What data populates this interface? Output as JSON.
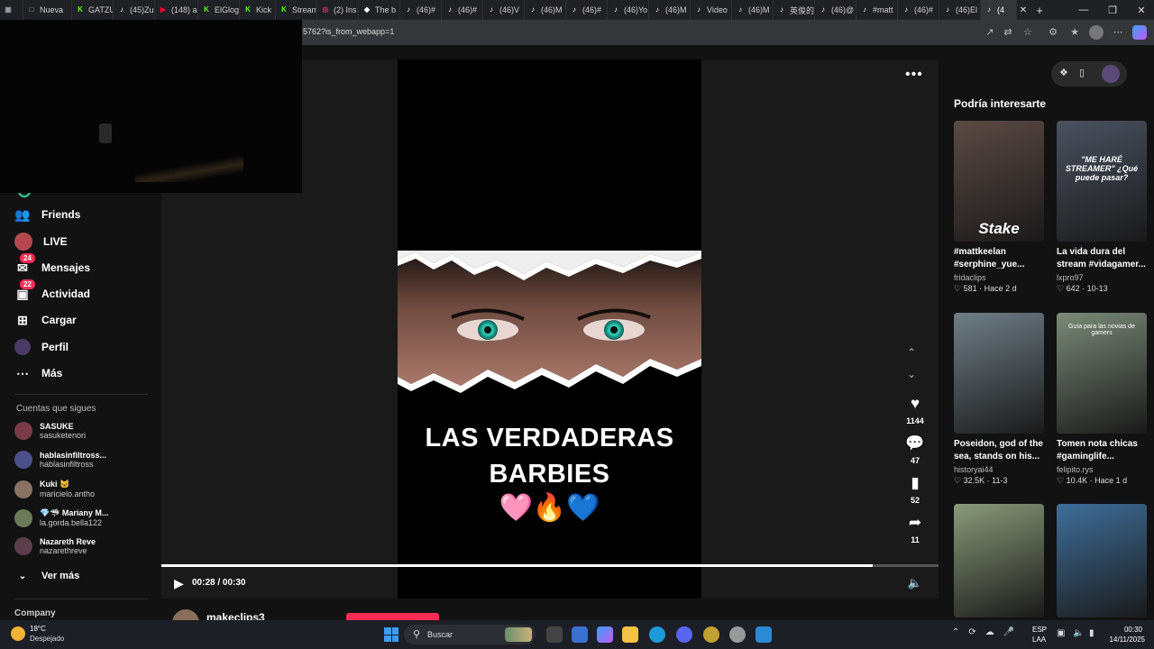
{
  "browser": {
    "tabs": [
      {
        "label": "",
        "icon": "window-icon",
        "color": "#9aa0a6"
      },
      {
        "label": "Nueva",
        "icon": "newtab-icon",
        "color": "#9aa0a6"
      },
      {
        "label": "GATZU",
        "icon": "kick-icon",
        "color": "#53fc18"
      },
      {
        "label": "(45)Zu",
        "icon": "tiktok-icon",
        "color": "#ffffff"
      },
      {
        "label": "(148) a",
        "icon": "youtube-icon",
        "color": "#ff0033"
      },
      {
        "label": "ElGlog",
        "icon": "kick-icon",
        "color": "#53fc18"
      },
      {
        "label": "Kick",
        "icon": "kick-icon",
        "color": "#53fc18"
      },
      {
        "label": "Stream",
        "icon": "kick-icon",
        "color": "#53fc18"
      },
      {
        "label": "(2) Ins",
        "icon": "instagram-icon",
        "color": "#e1306c"
      },
      {
        "label": "The b",
        "icon": "site-icon",
        "color": "#ffffff"
      },
      {
        "label": "(46)#",
        "icon": "tiktok-icon",
        "color": "#ffffff"
      },
      {
        "label": "(46)#",
        "icon": "tiktok-icon",
        "color": "#ffffff"
      },
      {
        "label": "(46)V",
        "icon": "tiktok-icon",
        "color": "#ffffff"
      },
      {
        "label": "(46)M",
        "icon": "tiktok-icon",
        "color": "#ffffff"
      },
      {
        "label": "(46)#",
        "icon": "tiktok-icon",
        "color": "#ffffff"
      },
      {
        "label": "(46)Yo",
        "icon": "tiktok-icon",
        "color": "#ffffff"
      },
      {
        "label": "(46)M",
        "icon": "tiktok-icon",
        "color": "#ffffff"
      },
      {
        "label": "Video",
        "icon": "tiktok-icon",
        "color": "#ffffff"
      },
      {
        "label": "(46)M",
        "icon": "tiktok-icon",
        "color": "#ffffff"
      },
      {
        "label": "英俊的",
        "icon": "tiktok-icon",
        "color": "#ffffff"
      },
      {
        "label": "(46)@",
        "icon": "tiktok-icon",
        "color": "#ffffff"
      },
      {
        "label": "#matt",
        "icon": "tiktok-icon",
        "color": "#ffffff"
      },
      {
        "label": "(46)#",
        "icon": "tiktok-icon",
        "color": "#ffffff"
      },
      {
        "label": "(46)El",
        "icon": "tiktok-icon",
        "color": "#ffffff"
      },
      {
        "label": "(4",
        "icon": "tiktok-icon",
        "color": "#ffffff",
        "active": true
      }
    ],
    "url": "5762?is_from_webapp=1"
  },
  "sidebar": {
    "nav": [
      {
        "label": "Friends",
        "icon": "friends-icon"
      },
      {
        "label": "LIVE",
        "icon": "live-icon"
      },
      {
        "label": "Mensajes",
        "icon": "messages-icon",
        "badge": "24"
      },
      {
        "label": "Actividad",
        "icon": "activity-icon",
        "badge": "22"
      },
      {
        "label": "Cargar",
        "icon": "upload-icon"
      },
      {
        "label": "Perfil",
        "icon": "profile-icon"
      },
      {
        "label": "Más",
        "icon": "more-icon"
      }
    ],
    "following_title": "Cuentas que sigues",
    "following": [
      {
        "name": "SASUKE",
        "handle": "sasuketenori",
        "color": "#7a3b48"
      },
      {
        "name": "hablasinfiltross...",
        "handle": "hablasinfiltross",
        "color": "#4b4f8a"
      },
      {
        "name": "Kuki 🐱",
        "handle": "maricielo.antho",
        "color": "#8a7263"
      },
      {
        "name": "💎🦈 Mariany M...",
        "handle": "la.gorda.bella122",
        "color": "#6b7a58"
      },
      {
        "name": "Nazareth Reve",
        "handle": "nazarethreve",
        "color": "#5a3f4a"
      }
    ],
    "see_more": "Ver más",
    "company": "Company"
  },
  "video": {
    "caption_line1": "LAS VERDADERAS",
    "caption_line2": "BARBIES",
    "emojis": "🩷🔥💙",
    "time": "00:28 / 00:30",
    "progress": 0.915,
    "author": "makeclips3",
    "likes": "1144",
    "comments": "47",
    "saves": "52",
    "shares": "11"
  },
  "recommendations": {
    "title": "Podría interesarte",
    "cards": [
      {
        "title": "#mattkeelan #serphine_yue...",
        "author": "fridaclips",
        "likes": "581",
        "when": "Hace 2 d",
        "bg": "#5b4a44",
        "overlay": "Stake"
      },
      {
        "title": "La vida dura del stream #vidagamer...",
        "author": "lxpro97",
        "likes": "642",
        "when": "10-13",
        "bg": "#4a5260",
        "overlay": "\"ME HARÉ STREAMER\" ¿Qué puede pasar?"
      },
      {
        "title": "Poseidon, god of the sea, stands on his...",
        "author": "historyai44",
        "likes": "32.5K",
        "when": "11-3",
        "bg": "#6f7e86",
        "overlay": ""
      },
      {
        "title": "Tomen nota chicas #gaminglife...",
        "author": "felipito.rys",
        "likes": "10.4K",
        "when": "Hace 1 d",
        "bg": "#7a8a78",
        "overlay": "Guía para las novias de gamers"
      },
      {
        "title": "",
        "author": "",
        "likes": "",
        "when": "",
        "bg": "#8a9a7a",
        "overlay": ""
      },
      {
        "title": "",
        "author": "",
        "likes": "",
        "when": "",
        "bg": "#3f6e9a",
        "overlay": ""
      }
    ]
  },
  "taskbar": {
    "temp": "18°C",
    "weather": "Despejado",
    "search_placeholder": "Buscar",
    "lang1": "ESP",
    "lang2": "LAA",
    "time": "00:30",
    "date": "14/11/2025"
  }
}
